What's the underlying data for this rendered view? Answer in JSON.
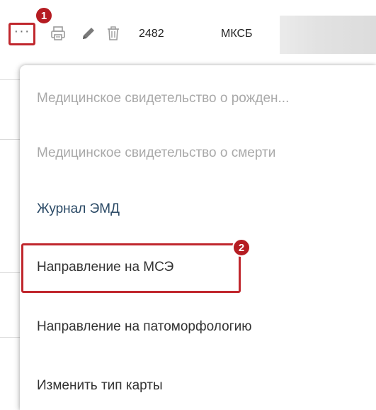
{
  "toolbar": {
    "more_icon": "more-horizontal-icon",
    "more_glyph": "···",
    "print_icon": "print-icon",
    "edit_icon": "pencil-icon",
    "delete_icon": "trash-icon",
    "row_number": "2482",
    "row_type": "МКСБ"
  },
  "annotations": {
    "badge_1": "1",
    "badge_2": "2",
    "accent_color": "#c0272d"
  },
  "menu": {
    "items": [
      {
        "label": "Медицинское свидетельство о рожден...",
        "state": "disabled"
      },
      {
        "label": "Медицинское свидетельство о смерти",
        "state": "disabled"
      },
      {
        "label": "Журнал ЭМД",
        "state": "enabled"
      },
      {
        "label": "Направление на МСЭ",
        "state": "enabled"
      },
      {
        "label": "Направление на патоморфологию",
        "state": "enabled"
      },
      {
        "label": "Изменить тип карты",
        "state": "enabled"
      }
    ]
  }
}
